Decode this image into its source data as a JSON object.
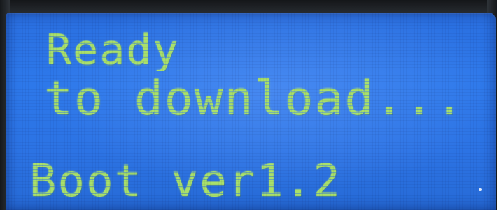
{
  "display": {
    "line1": "Ready",
    "line2": "to download...",
    "line3": "Boot ver1.2"
  },
  "colors": {
    "lcd_background": "#2c73e4",
    "lcd_text": "#a9e06b",
    "bezel": "#262a2f"
  }
}
